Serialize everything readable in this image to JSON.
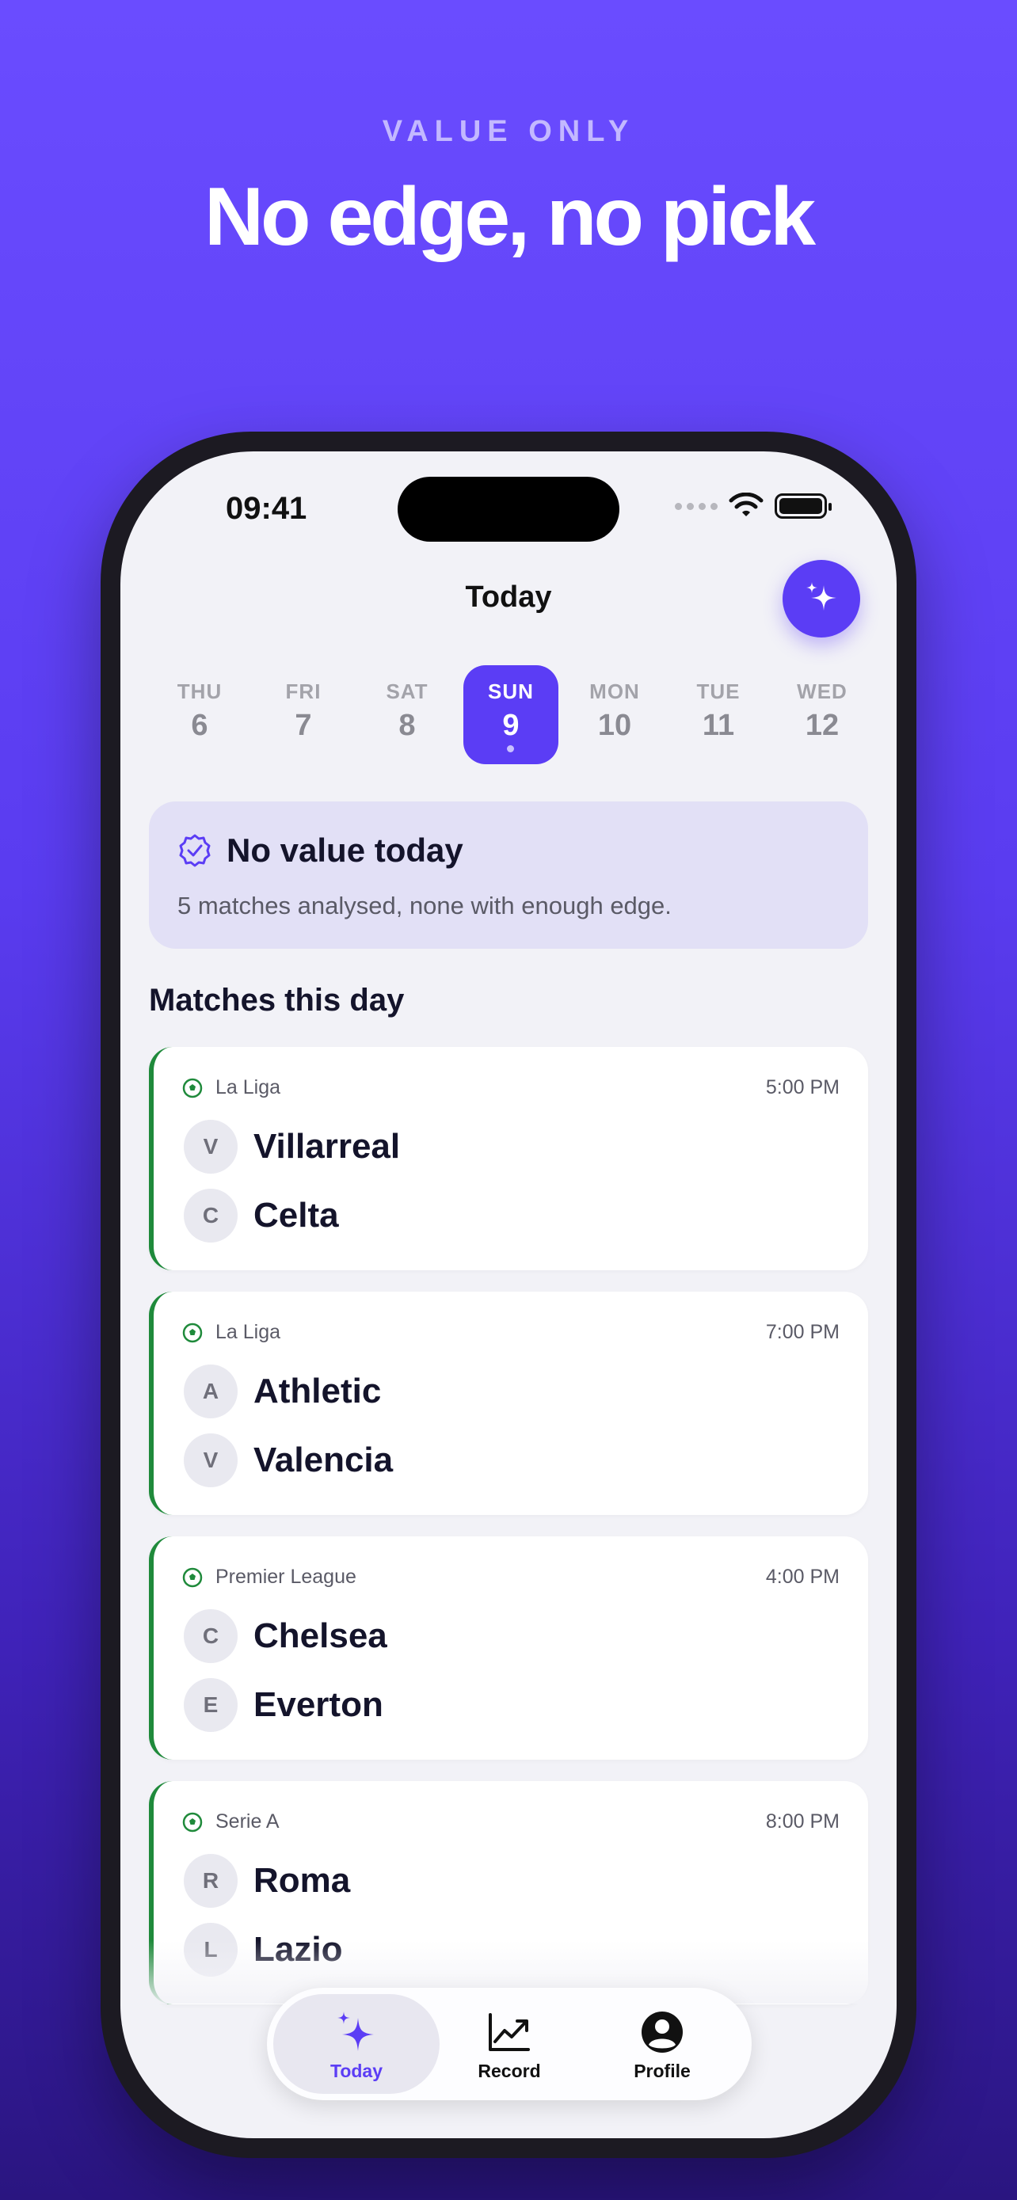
{
  "promo": {
    "eyebrow": "VALUE ONLY",
    "headline": "No edge, no pick"
  },
  "status_bar": {
    "time": "09:41"
  },
  "nav": {
    "title": "Today",
    "fab_icon": "sparkles-icon"
  },
  "days": [
    {
      "name": "THU",
      "num": "6"
    },
    {
      "name": "FRI",
      "num": "7"
    },
    {
      "name": "SAT",
      "num": "8"
    },
    {
      "name": "SUN",
      "num": "9",
      "selected": true
    },
    {
      "name": "MON",
      "num": "10"
    },
    {
      "name": "TUE",
      "num": "11"
    },
    {
      "name": "WED",
      "num": "12"
    }
  ],
  "banner": {
    "title": "No value today",
    "subtitle": "5 matches analysed, none with enough edge."
  },
  "section_title": "Matches this day",
  "matches": [
    {
      "league": "La Liga",
      "time": "5:00 PM",
      "home": {
        "initial": "V",
        "name": "Villarreal"
      },
      "away": {
        "initial": "C",
        "name": "Celta"
      }
    },
    {
      "league": "La Liga",
      "time": "7:00 PM",
      "home": {
        "initial": "A",
        "name": "Athletic"
      },
      "away": {
        "initial": "V",
        "name": "Valencia"
      }
    },
    {
      "league": "Premier League",
      "time": "4:00 PM",
      "home": {
        "initial": "C",
        "name": "Chelsea"
      },
      "away": {
        "initial": "E",
        "name": "Everton"
      }
    },
    {
      "league": "Serie A",
      "time": "8:00 PM",
      "home": {
        "initial": "R",
        "name": "Roma"
      },
      "away": {
        "initial": "L",
        "name": "Lazio"
      }
    }
  ],
  "tabs": [
    {
      "label": "Today",
      "icon": "sparkles-icon",
      "active": true
    },
    {
      "label": "Record",
      "icon": "chart-trend-icon"
    },
    {
      "label": "Profile",
      "icon": "person-circle-icon"
    }
  ],
  "colors": {
    "accent": "#5b3df5",
    "league_green": "#1f8a3b",
    "banner_bg": "#e2e0f6"
  }
}
